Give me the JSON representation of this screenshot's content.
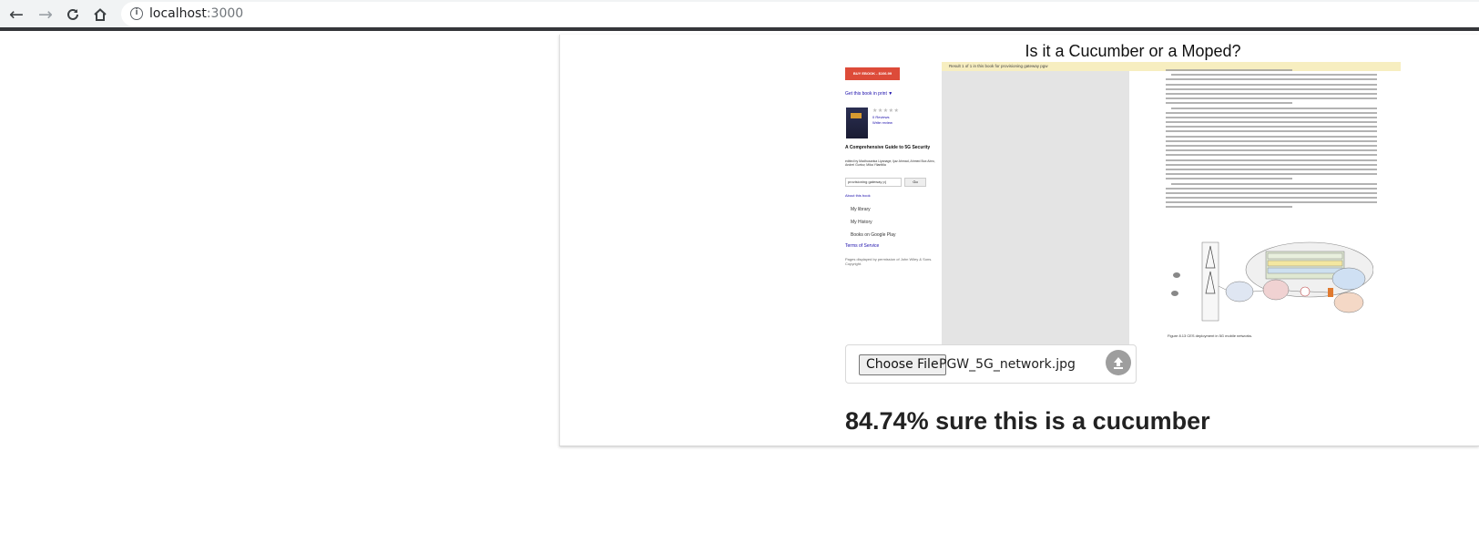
{
  "browser": {
    "back_icon": "arrow-left-icon",
    "forward_icon": "arrow-right-icon",
    "reload_icon": "reload-icon",
    "home_icon": "home-icon",
    "url_host": "localhost",
    "url_port": ":3000"
  },
  "app": {
    "title": "Is it a Cucumber or a Moped?",
    "upload": {
      "button_label": "Choose File",
      "file_name": "PGW_5G_network.jpg",
      "icon": "upload-icon"
    },
    "result": "84.74% sure this is a cucumber"
  },
  "preview": {
    "buy_label": "BUY EBOOK - $106.99",
    "get_print": "Get this book in print ▼",
    "reviews": "0 Reviews",
    "write_review": "Write review",
    "book_title": "A Comprehensive Guide to 5G Security",
    "authors": "edited by Madhusanka Liyanage, Ijaz Ahmad, Ahmed Bux Abro, Andrei Gurtov, Mika Ylianttila",
    "search_value": "provisioning gateway p(",
    "go_label": "Go",
    "about": "About this book",
    "menu": [
      "My library",
      "My History",
      "Books on Google Play"
    ],
    "terms": "Terms of Service",
    "footer": "Pages displayed by permission of John Wiley & Sons. Copyright.",
    "banner": "Result 1 of 1 in this book for provisioning gateway pgw",
    "figure_caption": "Figure 8.13 CES deployment in 5G mobile networks."
  }
}
